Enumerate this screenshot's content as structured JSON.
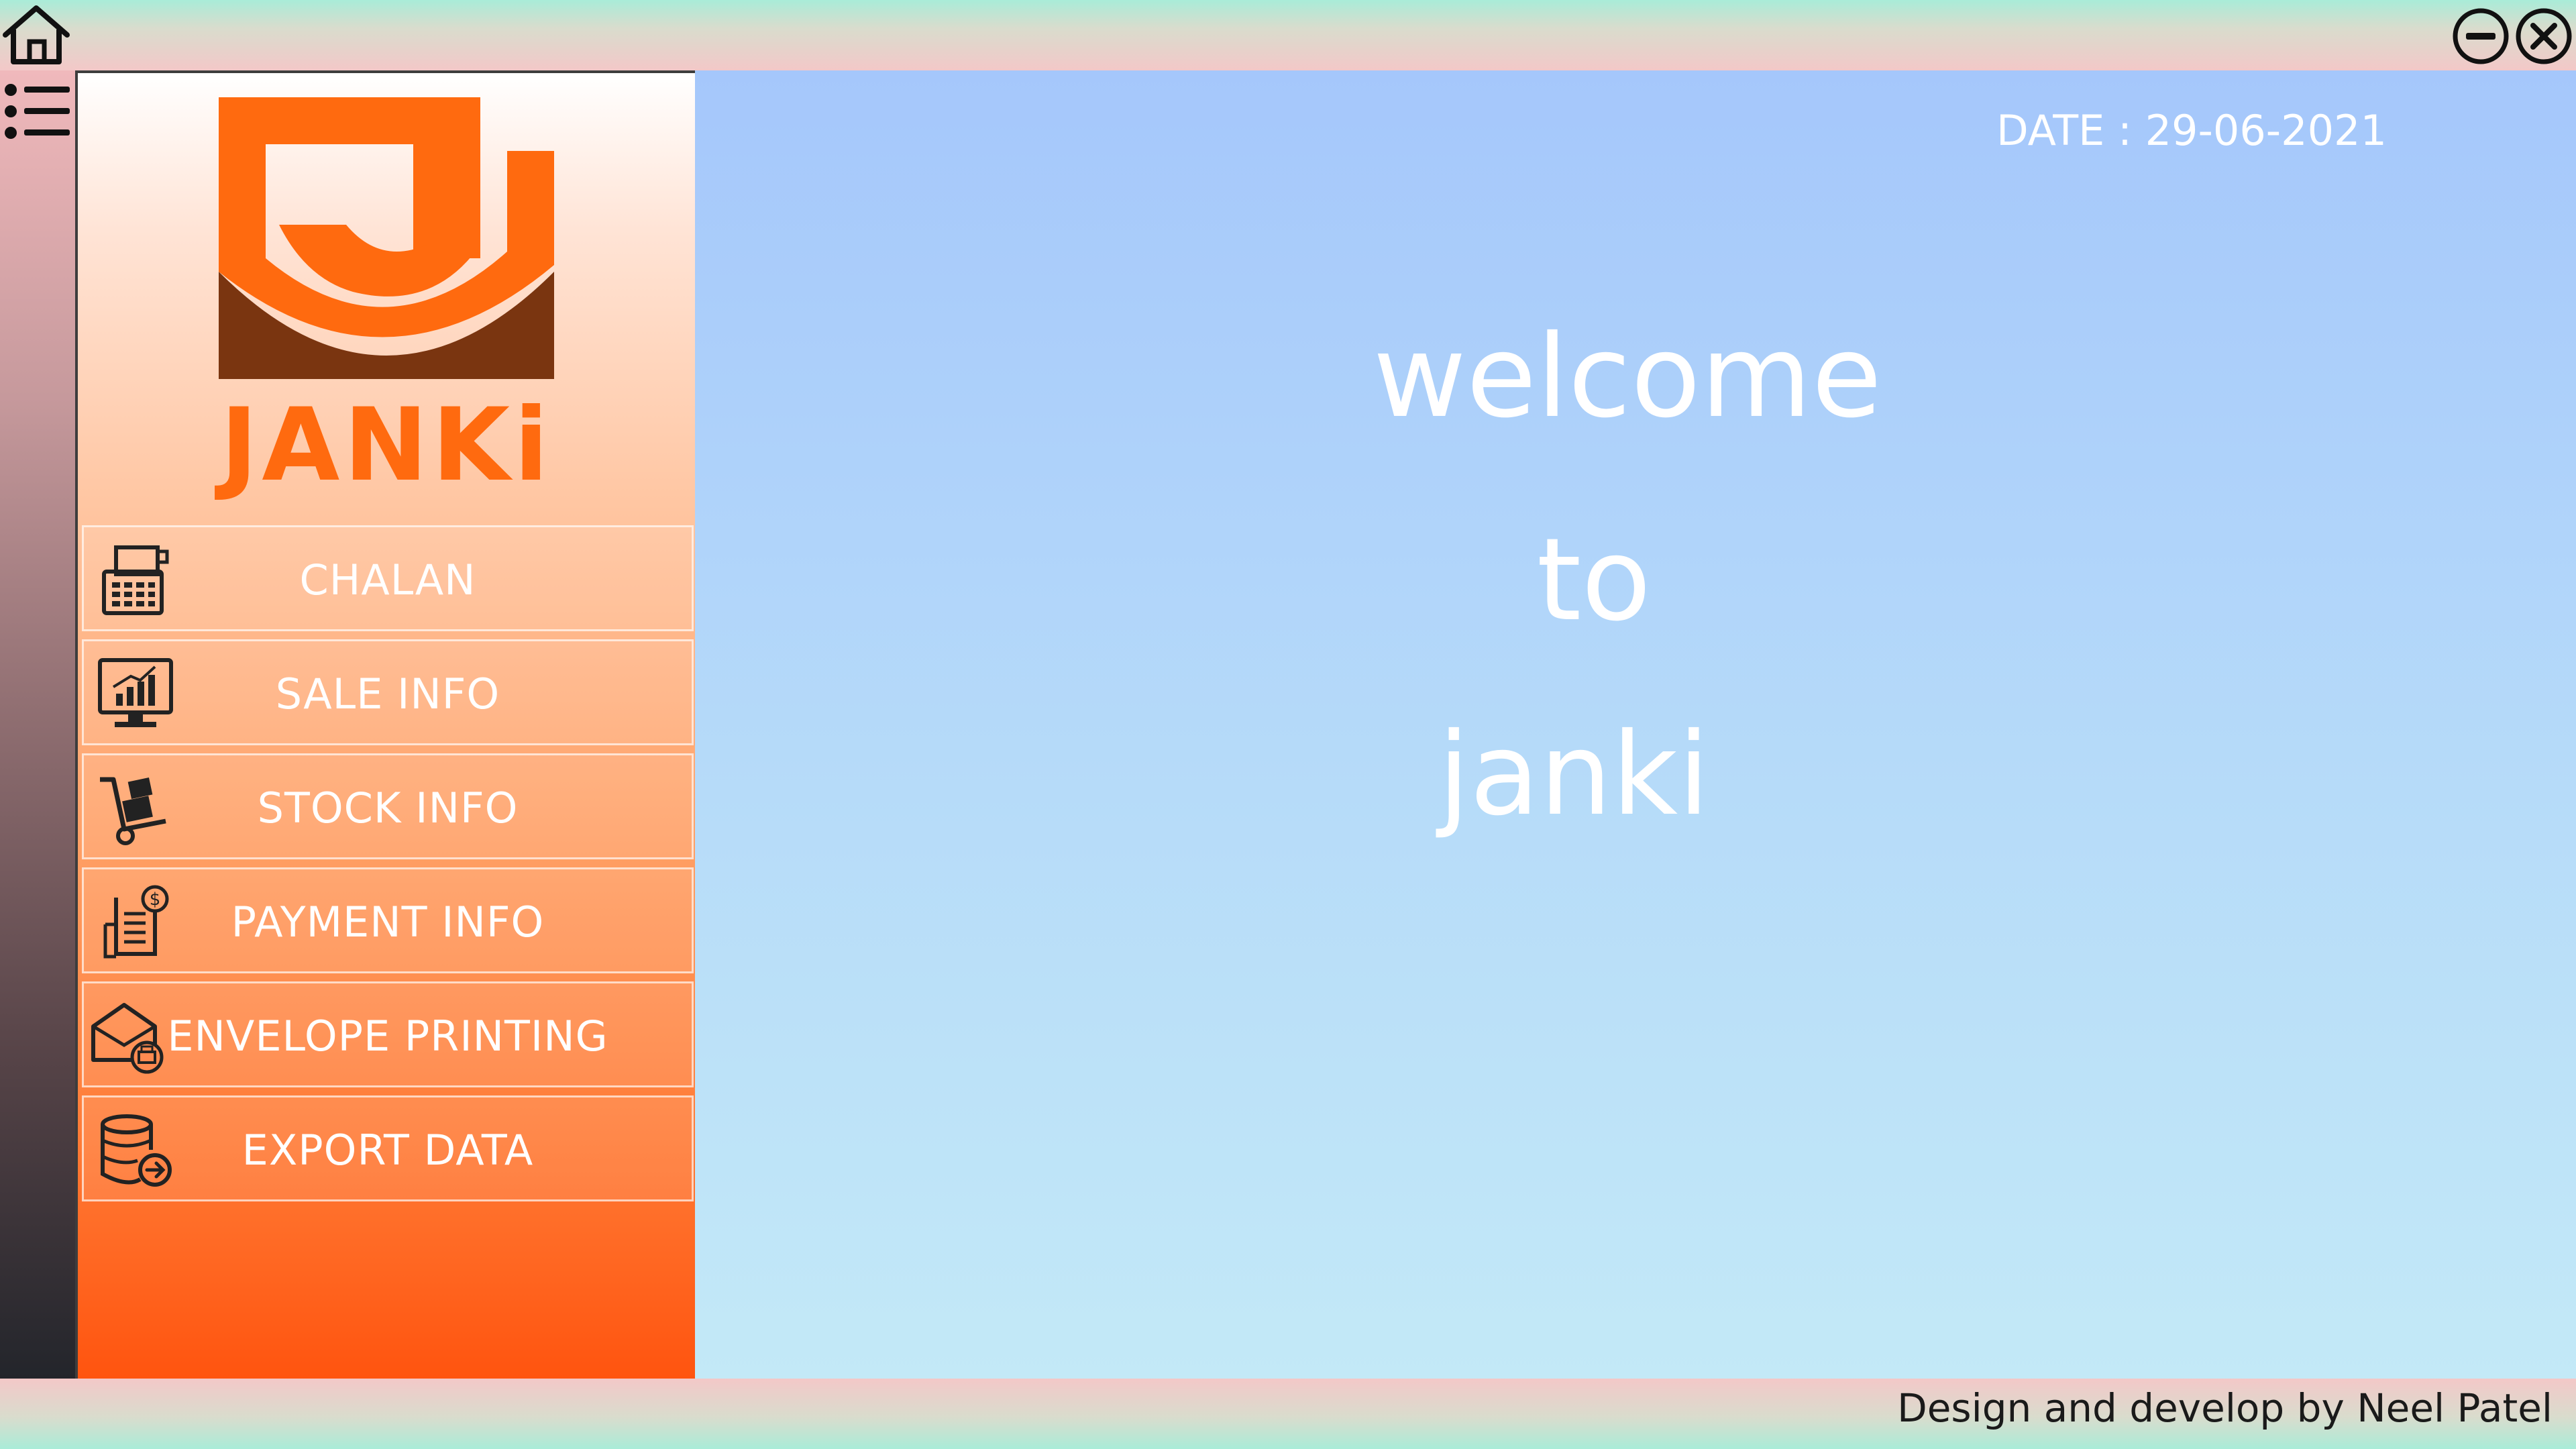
{
  "app": {
    "brand_name": "JANKi",
    "date_text": "DATE :  29-06-2021",
    "welcome": [
      "welcome",
      "to",
      "janki"
    ],
    "credit": "Design and develop by Neel Patel"
  },
  "sidebar": {
    "items": [
      {
        "label": "CHALAN",
        "icon": "cash-register-icon"
      },
      {
        "label": "SALE INFO",
        "icon": "monitor-chart-icon"
      },
      {
        "label": "STOCK INFO",
        "icon": "hand-truck-icon"
      },
      {
        "label": "PAYMENT INFO",
        "icon": "invoice-dollar-icon"
      },
      {
        "label": "ENVELOPE PRINTING",
        "icon": "envelope-print-icon"
      },
      {
        "label": "EXPORT DATA",
        "icon": "database-export-icon"
      }
    ]
  },
  "colors": {
    "accent": "#ff6a0f",
    "logo_dark": "#7a3510",
    "main_bg_top": "#a5c7fb",
    "main_bg_bottom": "#c3e9f7"
  },
  "icons": [
    "home-icon",
    "menu-list-icon",
    "minimize-icon",
    "close-icon"
  ]
}
